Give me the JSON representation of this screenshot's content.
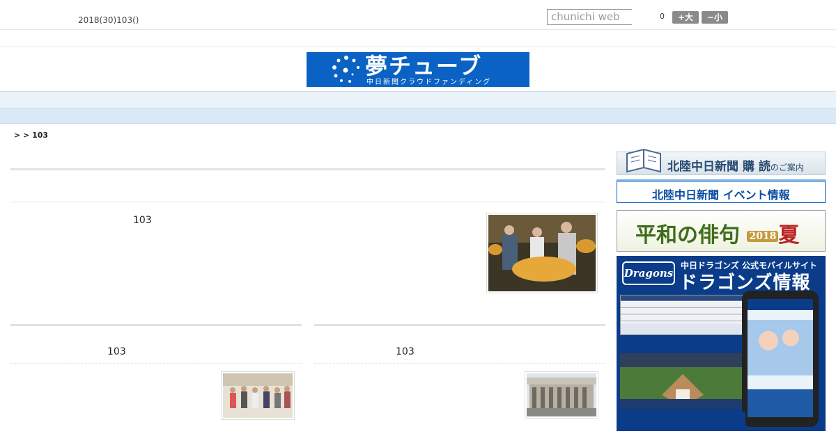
{
  "header": {
    "date": "2018(30)103()",
    "search_placeholder": "chunichi web",
    "font_count": "0",
    "font_big": "+大",
    "font_small": "−小"
  },
  "logo": {
    "title": "夢チューブ",
    "subtitle": "中日新聞クラウドファンディング"
  },
  "nav": {
    "items": [
      "",
      "",
      "",
      "",
      "",
      "",
      "",
      "",
      ""
    ]
  },
  "breadcrumb": ">  > 103",
  "articles": [
    {
      "title": "103"
    },
    {
      "title": "103"
    },
    {
      "title": "103"
    }
  ],
  "sidebar": {
    "subscribe": {
      "text": "北陸中日新聞",
      "emph": "購 読",
      "suffix": "のご案内"
    },
    "events": {
      "text": "北陸中日新聞 イベント情報"
    },
    "haiku": {
      "title": "平和の俳句",
      "year": "2018",
      "season": "夏"
    },
    "dragons": {
      "logo": "Dragons",
      "line1": "中日ドラゴンズ 公式モバイルサイト",
      "line2": "ドラゴンズ情報"
    }
  }
}
